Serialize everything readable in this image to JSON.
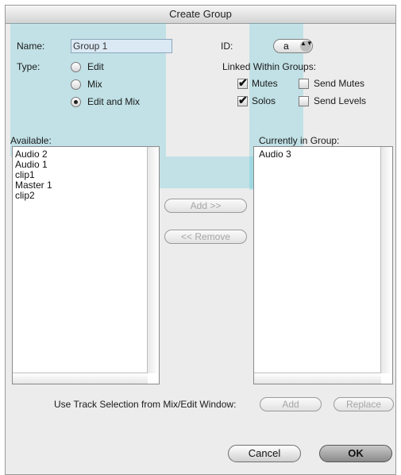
{
  "window": {
    "title": "Create Group"
  },
  "form": {
    "name_label": "Name:",
    "name_value": "Group 1",
    "id_label": "ID:",
    "id_value": "a",
    "type_label": "Type:",
    "type_options": [
      {
        "label": "Edit",
        "selected": false
      },
      {
        "label": "Mix",
        "selected": false
      },
      {
        "label": "Edit and Mix",
        "selected": true
      }
    ],
    "linked_label": "Linked Within Groups:",
    "linked_options": {
      "mutes": {
        "label": "Mutes",
        "checked": true
      },
      "send_mutes": {
        "label": "Send Mutes",
        "checked": false
      },
      "solos": {
        "label": "Solos",
        "checked": true
      },
      "send_levels": {
        "label": "Send Levels",
        "checked": false
      }
    }
  },
  "available": {
    "label": "Available:",
    "items": [
      "Audio 2",
      "Audio 1",
      "clip1",
      "Master 1",
      "clip2"
    ]
  },
  "current": {
    "label": "Currently in Group:",
    "items": [
      "Audio 3"
    ]
  },
  "buttons": {
    "add_transfer": "Add >>",
    "remove_transfer": "<< Remove",
    "track_selection_label": "Use Track Selection from Mix/Edit Window:",
    "add": "Add",
    "replace": "Replace",
    "cancel": "Cancel",
    "ok": "OK"
  },
  "icons": {
    "checkmark": "✔",
    "popup_arrows": "▲▼"
  },
  "colors": {
    "dialog_bg": "#ececec",
    "name_field_bg": "#dbe9f4",
    "watermark": "#3ec0d4"
  }
}
